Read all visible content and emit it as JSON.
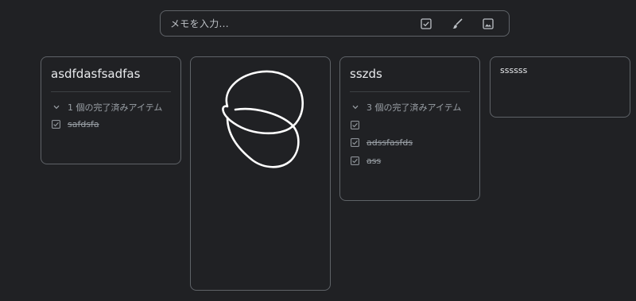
{
  "note_bar": {
    "placeholder": "メモを入力...",
    "icons": [
      "checkbox-icon",
      "brush-icon",
      "image-icon"
    ]
  },
  "cards": [
    {
      "title": "asdfdasfsadfas",
      "completed_label": "1 個の完了済みアイテム",
      "items": [
        {
          "text": "safdsfa",
          "checked": true
        }
      ]
    },
    {
      "type": "drawing"
    },
    {
      "title": "sszds",
      "completed_label": "3 個の完了済みアイテム",
      "items": [
        {
          "text": "",
          "checked": true
        },
        {
          "text": "adssfasfds",
          "checked": true
        },
        {
          "text": "ass",
          "checked": true
        }
      ]
    },
    {
      "title": "ssssss"
    }
  ],
  "colors": {
    "background": "#202124",
    "border": "#5f6368",
    "text": "#e8eaed",
    "muted_text": "#9aa0a6"
  }
}
